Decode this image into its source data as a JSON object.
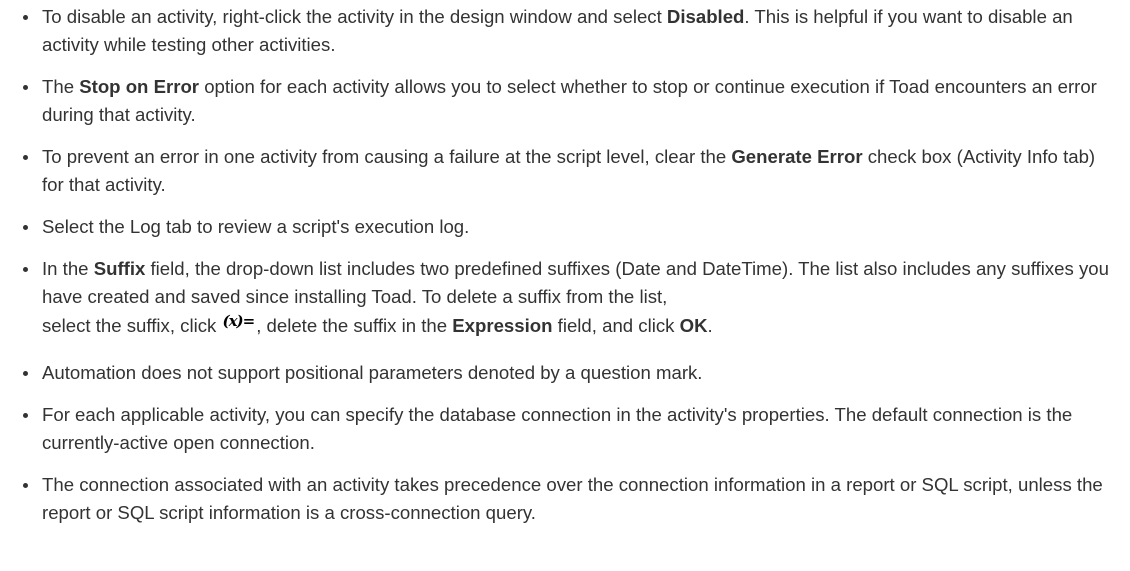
{
  "bullets": [
    {
      "a": "To disable an activity, right-click the activity in the design window and select ",
      "b1": "Disabled",
      "c": ". This is helpful if you want to disable an activity while testing other activities."
    },
    {
      "a": "The ",
      "b1": "Stop on Error",
      "c": " option for each activity allows you to select whether to stop or continue execution if Toad encounters an error during that activity."
    },
    {
      "a": "To prevent an error in one activity from causing a failure at the script level, clear the ",
      "b1": "Generate Error",
      "c": " check box (Activity Info tab) for that activity."
    },
    {
      "a": "Select the Log tab to review a script's execution log."
    },
    {
      "a": "In the ",
      "b1": "Suffix",
      "c": " field, the drop-down list includes two predefined suffixes (Date and DateTime). The list also includes any suffixes you have created and saved since installing Toad. To delete a suffix from the list,",
      "d": "select the suffix, click ",
      "icon": "(x)=",
      "e": ", delete the suffix in the ",
      "b2": "Expression",
      "f": " field, and click ",
      "b3": "OK",
      "g": "."
    },
    {
      "a": "Automation does not support positional parameters denoted by a question mark."
    },
    {
      "a": "For each applicable activity, you can specify the database connection in the activity's properties. The default connection is the currently-active open connection."
    },
    {
      "a": "The connection associated with an activity takes precedence over the connection information in a report or SQL script, unless the report or SQL script information is a cross-connection query."
    }
  ]
}
